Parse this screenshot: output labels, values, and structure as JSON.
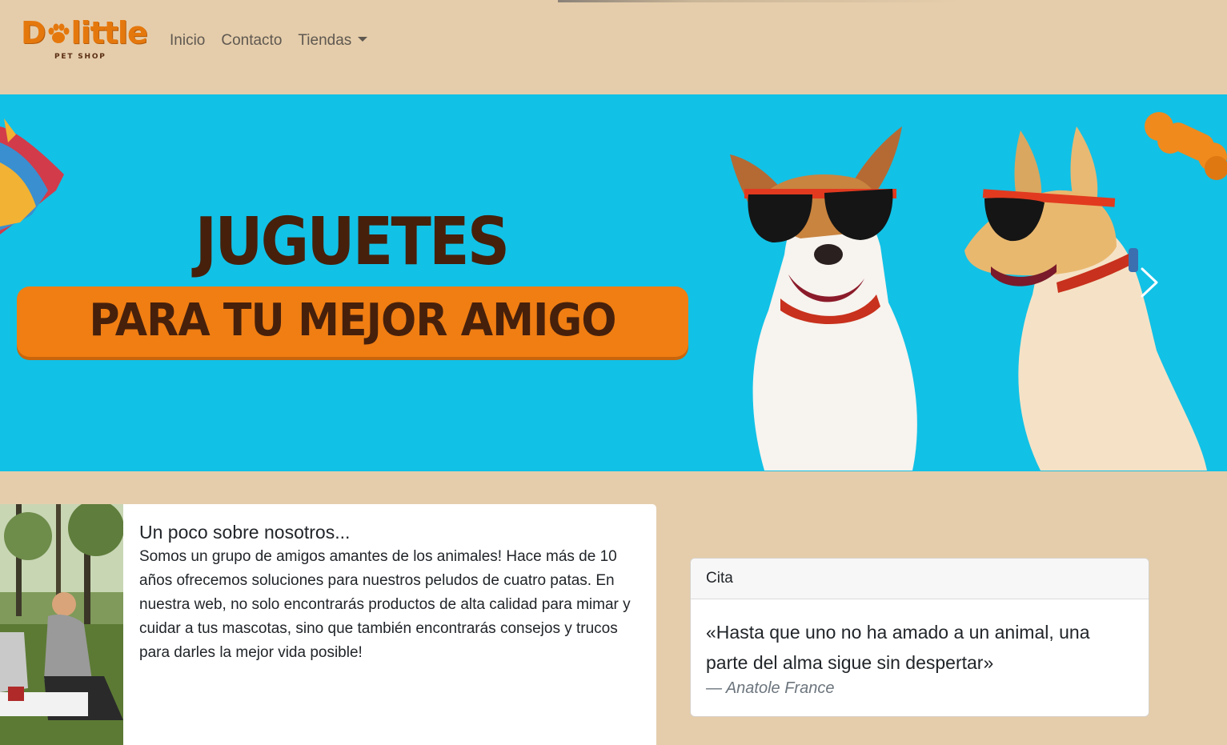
{
  "brand": {
    "logo_text": "Dolittle",
    "tagline": "PET SHOP",
    "logo_color": "#e5780d"
  },
  "nav": {
    "items": [
      {
        "label": "Inicio"
      },
      {
        "label": "Contacto"
      },
      {
        "label": "Tiendas",
        "has_dropdown": true
      }
    ]
  },
  "carousel": {
    "headline": "JUGUETES",
    "subheadline": "PARA TU MEJOR AMIGO",
    "background": "#12c1e6",
    "accent": "#f07e13",
    "next_icon": "chevron-right-icon"
  },
  "about": {
    "title": "Un poco sobre nosotros...",
    "text": "Somos un grupo de amigos amantes de los animales! Hace más de 10 años ofrecemos soluciones para nuestros peludos de cuatro patas. En nuestra web, no solo encontrarás productos de alta calidad para mimar y cuidar a tus mascotas, sino que también encontrarás consejos y trucos para darles la mejor vida posible!"
  },
  "quote": {
    "header": "Cita",
    "text": "«Hasta que uno no ha amado a un animal, una parte del alma sigue sin despertar»",
    "author": "— Anatole France"
  },
  "colors": {
    "page_bg": "#e5cdab",
    "text_brown": "#46200b"
  }
}
